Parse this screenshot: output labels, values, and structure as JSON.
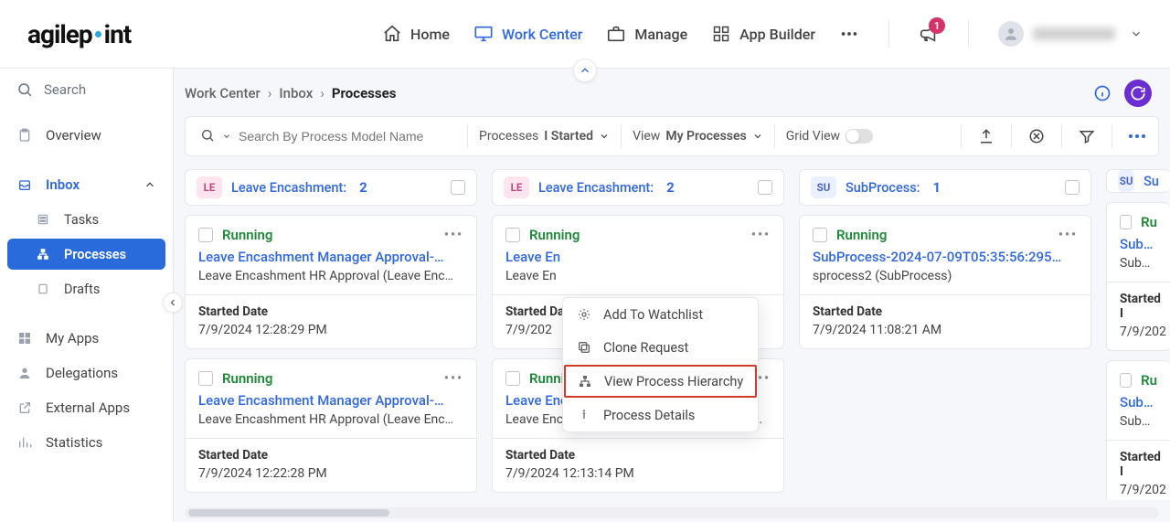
{
  "header": {
    "notification_count": "1",
    "nav": {
      "home": "Home",
      "work_center": "Work Center",
      "manage": "Manage",
      "app_builder": "App Builder"
    }
  },
  "sidebar": {
    "search_placeholder": "Search",
    "overview": "Overview",
    "inbox": "Inbox",
    "tasks": "Tasks",
    "processes": "Processes",
    "drafts": "Drafts",
    "my_apps": "My Apps",
    "delegations": "Delegations",
    "external_apps": "External Apps",
    "statistics": "Statistics"
  },
  "breadcrumb": {
    "a": "Work Center",
    "b": "Inbox",
    "c": "Processes"
  },
  "toolbar": {
    "search_placeholder": "Search By Process Model Name",
    "filter1a": "Processes",
    "filter1b": "I Started",
    "filter2a": "View",
    "filter2b": "My Processes",
    "grid_view": "Grid View"
  },
  "columns": {
    "le": {
      "pill": "LE",
      "title": "Leave Encashment:",
      "count": "2"
    },
    "su": {
      "pill": "SU",
      "title": "SubProcess:",
      "count": "1"
    },
    "su_partial_title": "Su"
  },
  "labels": {
    "started_date": "Started Date",
    "running": "Running"
  },
  "cards": {
    "c1": {
      "title": "Leave Encashment Manager Approval-…",
      "sub": "Leave Encashment HR Approval (Leave Enc…",
      "date": "7/9/2024 12:28:29 PM"
    },
    "c2_truncated": {
      "title": "Leave En",
      "sub": "Leave En",
      "date": "7/9/202"
    },
    "c3": {
      "title": "SubProcess-2024-07-09T05:35:56:295…",
      "sub": "sprocess2 (SubProcess)",
      "date": "7/9/2024 11:08:21 AM"
    },
    "c4": {
      "title": "Leave Encashment Manager Approval-…",
      "sub": "Leave Encashment HR Approval (Leave Enc…",
      "date": "7/9/2024 12:22:28 PM"
    },
    "c5": {
      "title": "Leave Encashment Manager Approval-…",
      "sub": "Leave Encashment Manager Approval (Leav…",
      "date": "7/9/2024 12:13:14 PM"
    },
    "c_partial_a": {
      "title": "SubPro",
      "sub": "SubPro",
      "date_label": "Started I",
      "date": "7/9/202",
      "running": "Ru"
    },
    "c_partial_b": {
      "title": "SubPro",
      "sub": "SubProc",
      "date_label": "Started I",
      "date": "7/9/202",
      "running": "Ru"
    }
  },
  "menu": {
    "add_watchlist": "Add To Watchlist",
    "clone": "Clone Request",
    "hierarchy": "View Process Hierarchy",
    "details": "Process Details"
  }
}
